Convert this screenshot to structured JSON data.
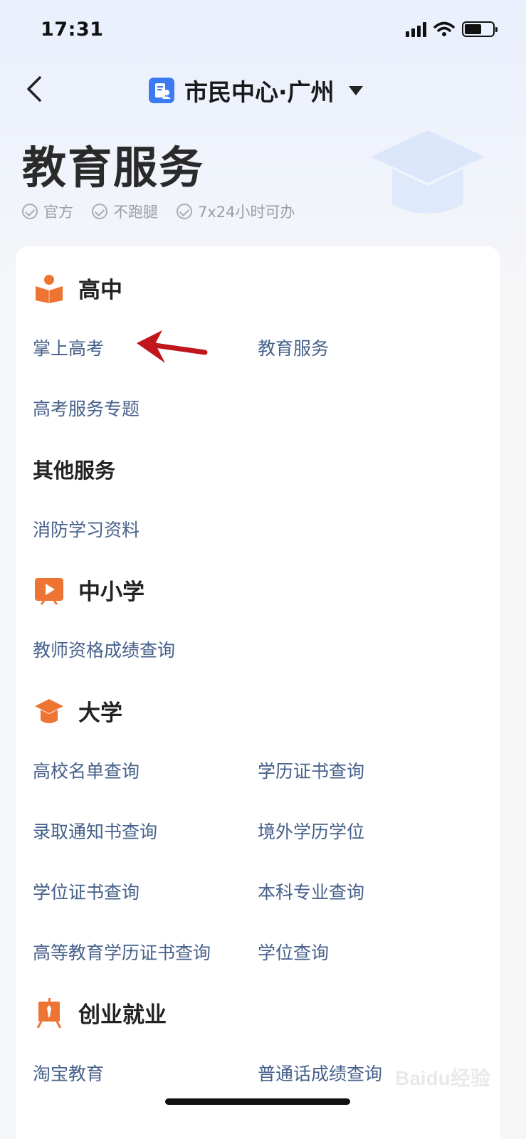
{
  "status_bar": {
    "time": "17:31"
  },
  "nav": {
    "title": "市民中心·广州"
  },
  "hero": {
    "title": "教育服务",
    "tags": [
      "官方",
      "不跑腿",
      "7x24小时可办"
    ]
  },
  "sections": {
    "gaozhong": {
      "title": "高中",
      "links": [
        "掌上高考",
        "教育服务",
        "高考服务专题"
      ]
    },
    "other": {
      "title": "其他服务",
      "links": [
        "消防学习资料"
      ]
    },
    "zhongxiaoxue": {
      "title": "中小学",
      "links": [
        "教师资格成绩查询"
      ]
    },
    "daxue": {
      "title": "大学",
      "links": [
        "高校名单查询",
        "学历证书查询",
        "录取通知书查询",
        "境外学历学位",
        "学位证书查询",
        "本科专业查询",
        "高等教育学历证书查询",
        "学位查询"
      ]
    },
    "chuangye": {
      "title": "创业就业",
      "links": [
        "淘宝教育",
        "普通话成绩查询"
      ]
    }
  },
  "watermark": {
    "text": "Baidu经验"
  },
  "colors": {
    "accent_orange": "#ee7434",
    "link_blue": "#46608a",
    "badge_blue": "#3d7bf5",
    "annotation_red": "#c0161c"
  }
}
